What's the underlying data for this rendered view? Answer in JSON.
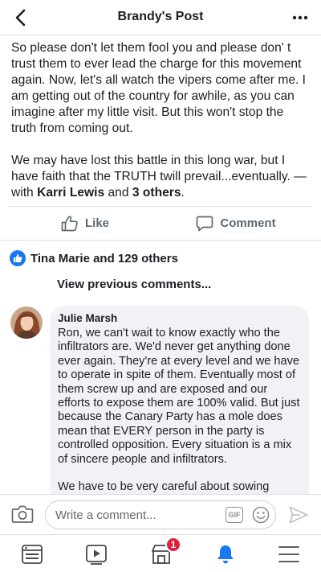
{
  "header": {
    "title": "Brandy's Post",
    "back_icon": "chevron-left-icon",
    "more_icon": "more-dots-icon"
  },
  "post": {
    "paragraph1": "So please don't let them fool you and please don' t trust them to ever lead the charge for this movement again. Now, let's all watch the vipers come after me. I am getting out of the country for awhile, as you can imagine after my little visit. But this won't stop the truth from coming out.",
    "paragraph2_text": "We may have lost this battle in this long war, but I have faith that the TRUTH twill prevail...eventually. — with ",
    "tagged_person": "Karri Lewis",
    "and_text": " and ",
    "others_text": "3 others",
    "period": "."
  },
  "actions": {
    "like_label": "Like",
    "comment_label": "Comment"
  },
  "reactions": {
    "summary": "Tina Marie and 129 others"
  },
  "comments": {
    "view_previous": "View previous comments...",
    "items": [
      {
        "author": "Julie Marsh",
        "paragraph1": "Ron, we can't wait to know exactly who the infiltrators are. We'd never get anything done ever again. They're at every level and we have to operate in spite of them. Eventually most of them screw up and are exposed and our efforts to expose them are 100% valid. But just because the Canary Party has a mole does mean that EVERY person in the party is controlled opposition. Every situation is a mix of sincere people and infiltrators.",
        "paragraph2": "We have to be very careful about sowing"
      }
    ]
  },
  "composer": {
    "placeholder": "Write a comment...",
    "gif_label": "GIF"
  },
  "tabbar": {
    "notification_badge": "1",
    "accent_color": "#1877f2"
  },
  "colors": {
    "brand": "#1877f2",
    "badge": "#e41e3f",
    "bubble": "#f0f2f5"
  }
}
